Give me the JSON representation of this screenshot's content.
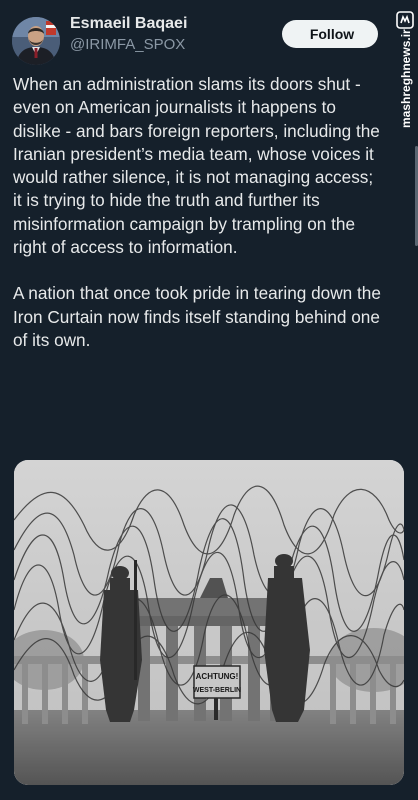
{
  "author": {
    "display_name": "Esmaeil Baqaei",
    "handle": "@IRIMFA_SPOX",
    "avatar_icon": "person-portrait-icon"
  },
  "follow_button": {
    "label": "Follow"
  },
  "watermark": {
    "text": "mashreghnews.ir",
    "logo_icon": "mashregh-logo-icon"
  },
  "tweet": {
    "paragraphs": [
      "When an administration slams its doors shut - even on American journalists it happens to dislike - and bars foreign reporters, including the Iranian president’s media team, whose voices it would rather silence, it is not managing access; it is trying to hide the truth and further its misinformation campaign by trampling on the right of access to information.",
      "A nation that once took pride in tearing down the Iron Curtain now finds itself standing behind one of its own."
    ]
  },
  "media": {
    "description_icon": "brandenburg-gate-barbed-wire-photo",
    "sign_lines": [
      "ACHTUNG!",
      "WEST-BERLIN"
    ]
  },
  "colors": {
    "background": "#15202b",
    "text": "#e7e9ea",
    "secondary_text": "#8b98a5",
    "button_bg": "#eff3f4"
  }
}
